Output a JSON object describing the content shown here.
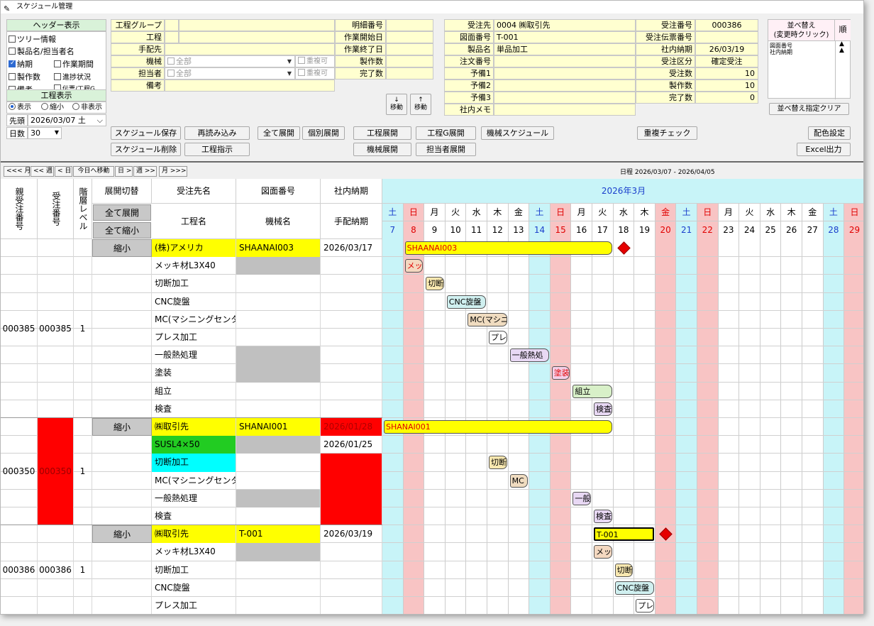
{
  "window_title": "スケジュール管理",
  "header_panel": {
    "title": "ヘッダー表示",
    "opt_tree": "ツリー情報",
    "opt_product": "製品名/担当者名",
    "opt_due": "納期",
    "opt_workperiod": "作業期間",
    "opt_qty": "製作数",
    "opt_progress": "進捗状況",
    "opt_note": "備考",
    "opt_slip": "伝票/工程G",
    "process_title": "工程表示",
    "radio_show": "表示",
    "radio_shrink": "縮小",
    "radio_hide": "非表示",
    "start_label": "先頭",
    "start_value": "2026/03/07 土",
    "days_label": "日数",
    "days_value": "30"
  },
  "filter": {
    "process_group": "工程グループ",
    "process": "工程",
    "arranger": "手配先",
    "machine": "機械",
    "machine_all": "全部",
    "dup1": "重複可",
    "staff": "担当者",
    "staff_all": "全部",
    "dup2": "重複可",
    "note": "備考",
    "detail_no": "明細番号",
    "work_start": "作業開始日",
    "work_end": "作業終了日",
    "produced": "製作数",
    "completed": "完了数"
  },
  "order": {
    "customer_label": "受注先",
    "customer_value": "0004 ㈱取引先",
    "drawing_label": "図面番号",
    "drawing_value": "T-001",
    "product_label": "製品名",
    "product_value": "単品加工",
    "po_label": "注文番号",
    "spare1": "予備1",
    "spare2": "予備2",
    "spare3": "予備3",
    "memo": "社内メモ",
    "order_no_label": "受注番号",
    "order_no_value": "000386",
    "slip_label": "受注伝票番号",
    "due_label": "社内納期",
    "due_value": "26/03/19",
    "type_label": "受注区分",
    "type_value": "確定受注",
    "qty_label": "受注数",
    "qty_value": "10",
    "made_label": "製作数",
    "made_value": "10",
    "done_label": "完了数",
    "done_value": "0"
  },
  "move": {
    "down": "↓\n移動",
    "up": "↑\n移動",
    "down_arrow": "↓",
    "up_arrow": "↑",
    "word": "移動"
  },
  "sort": {
    "title": "並べ替え\n(変更時クリック)",
    "title1": "並べ替え",
    "title2": "(変更時クリック)",
    "order_col": "順",
    "item1": "図面番号",
    "item2": "社内納期",
    "arrow1": "▲",
    "arrow2": "▲",
    "clear": "並べ替え指定クリア"
  },
  "buttons": {
    "save": "スケジュール保存",
    "reload": "再読み込み",
    "expand_all": "全て展開",
    "expand_each": "個別展開",
    "process_expand": "工程展開",
    "processg_expand": "工程G展開",
    "machine_schedule": "機械スケジュール",
    "dup_check": "重複チェック",
    "color": "配色設定",
    "delete": "スケジュール削除",
    "instruct": "工程指示",
    "machine_expand": "機械展開",
    "staff_expand": "担当者展開",
    "excel": "Excel出力"
  },
  "nav": {
    "prev_month": "<<< 月",
    "prev_week": "<< 週",
    "prev_day": "< 日",
    "today": "今日へ移動",
    "next_day": "日 >",
    "next_week": "週 >>",
    "next_month": "月 >>>",
    "range": "日程  2026/03/07 - 2026/04/05"
  },
  "grid_header": {
    "parent_no": "親受注番号",
    "order_no": "受注番号",
    "level": "階層レベル",
    "toggle": "展開切替",
    "expand_all": "全て展開",
    "shrink_all": "全て縮小",
    "customer": "受注先名",
    "process": "工程名",
    "drawing": "図面番号",
    "machine": "機械名",
    "due": "社内納期",
    "arrange_due": "手配納期",
    "month": "2026年3月"
  },
  "days": [
    {
      "w": "土",
      "d": "7",
      "t": "sat"
    },
    {
      "w": "日",
      "d": "8",
      "t": "sun"
    },
    {
      "w": "月",
      "d": "9",
      "t": ""
    },
    {
      "w": "火",
      "d": "10",
      "t": ""
    },
    {
      "w": "水",
      "d": "11",
      "t": ""
    },
    {
      "w": "木",
      "d": "12",
      "t": ""
    },
    {
      "w": "金",
      "d": "13",
      "t": ""
    },
    {
      "w": "土",
      "d": "14",
      "t": "sat"
    },
    {
      "w": "日",
      "d": "15",
      "t": "sun"
    },
    {
      "w": "月",
      "d": "16",
      "t": ""
    },
    {
      "w": "火",
      "d": "17",
      "t": ""
    },
    {
      "w": "水",
      "d": "18",
      "t": ""
    },
    {
      "w": "木",
      "d": "19",
      "t": ""
    },
    {
      "w": "金",
      "d": "20",
      "t": "hol"
    },
    {
      "w": "土",
      "d": "21",
      "t": "sat"
    },
    {
      "w": "日",
      "d": "22",
      "t": "sun"
    },
    {
      "w": "月",
      "d": "23",
      "t": ""
    },
    {
      "w": "火",
      "d": "24",
      "t": ""
    },
    {
      "w": "水",
      "d": "25",
      "t": ""
    },
    {
      "w": "木",
      "d": "26",
      "t": ""
    },
    {
      "w": "金",
      "d": "27",
      "t": ""
    },
    {
      "w": "土",
      "d": "28",
      "t": "sat"
    },
    {
      "w": "日",
      "d": "29",
      "t": "sun"
    }
  ],
  "groups": [
    {
      "parent": "000385",
      "order": "000385",
      "level": "1",
      "order_red": false,
      "rows": [
        {
          "toggle": "縮小",
          "name": "(株)アメリカ",
          "name_bg": "#ffff00",
          "drawing": "SHAANAI003",
          "drawing_bg": "#ffff00",
          "due": "2026/03/17",
          "due_bg": "",
          "bar": {
            "label": "SHAANAI003",
            "start": 1,
            "end": 10,
            "color": "#ffff00",
            "text": "#e00000",
            "diamond": 11
          }
        },
        {
          "name": "メッキ材L3X40",
          "drawing": "",
          "drawing_bg": "#c0c0c0",
          "bar": {
            "label": "メッキ",
            "start": 1,
            "end": 1,
            "color": "#f4d8c0",
            "text": "#e00000"
          }
        },
        {
          "name": "切断加工",
          "bar": {
            "label": "切断加工",
            "start": 2,
            "end": 2,
            "color": "#f8e8b0",
            "text": "#000"
          }
        },
        {
          "name": "CNC旋盤",
          "bar": {
            "label": "CNC旋盤",
            "start": 3,
            "end": 4,
            "color": "#d0f0f0",
            "text": "#000"
          }
        },
        {
          "name": "MC(マシニングセンタ)",
          "bar": {
            "label": "MC(マシニ",
            "start": 4,
            "end": 5,
            "color": "#f0dcc0",
            "text": "#000"
          }
        },
        {
          "name": "プレス加工",
          "bar": {
            "label": "プレ",
            "start": 5,
            "end": 5,
            "color": "#ffffff",
            "text": "#000"
          }
        },
        {
          "name": "一般熱処理",
          "drawing": "",
          "drawing_bg": "#c0c0c0",
          "bar": {
            "label": "一般熱処",
            "start": 6,
            "end": 7,
            "color": "#e8d8f4",
            "text": "#000"
          }
        },
        {
          "name": "塗装",
          "drawing": "",
          "drawing_bg": "#c0c0c0",
          "bar": {
            "label": "塗装",
            "start": 8,
            "end": 8,
            "color": "#f4d0e8",
            "text": "#e00000"
          }
        },
        {
          "name": "組立",
          "bar": {
            "label": "組立",
            "start": 9,
            "end": 10,
            "color": "#d8f0c8",
            "text": "#000"
          }
        },
        {
          "name": "検査",
          "bar": {
            "label": "検査",
            "start": 10,
            "end": 10,
            "color": "#e8d8f4",
            "text": "#000"
          }
        }
      ]
    },
    {
      "parent": "000350",
      "order": "000350",
      "level": "1",
      "order_red": true,
      "rows": [
        {
          "toggle": "縮小",
          "name": "㈱取引先",
          "name_bg": "#ffff00",
          "drawing": "SHANAI001",
          "drawing_bg": "#ffff00",
          "due": "2026/01/28",
          "due_bg": "#ff0000",
          "bar": {
            "label": "SHANAI001",
            "start": 0,
            "end": 10,
            "color": "#ffff00",
            "text": "#e00000"
          }
        },
        {
          "name": "SUSL4×50",
          "name_bg": "#22cc22",
          "drawing": "",
          "drawing_bg": "#c0c0c0",
          "due": "2026/01/25",
          "due_bg": ""
        },
        {
          "name": "切断加工",
          "name_bg": "#00ffff",
          "due": "",
          "due_bg": "#ff0000",
          "bar": {
            "label": "切断",
            "start": 5,
            "end": 5,
            "color": "#f8e8b0",
            "text": "#000"
          }
        },
        {
          "name": "MC(マシニングセンタ)",
          "due_bg": "#ff0000",
          "bar": {
            "label": "MC",
            "start": 6,
            "end": 6,
            "color": "#f0dcc0",
            "text": "#000"
          }
        },
        {
          "name": "一般熱処理",
          "drawing": "",
          "drawing_bg": "#c0c0c0",
          "due_bg": "#ff0000",
          "bar": {
            "label": "一般",
            "start": 9,
            "end": 9,
            "color": "#e8d8f4",
            "text": "#000"
          }
        },
        {
          "name": "検査",
          "due_bg": "#ff0000",
          "bar": {
            "label": "検査",
            "start": 10,
            "end": 10,
            "color": "#e8d8f4",
            "text": "#000"
          }
        }
      ]
    },
    {
      "parent": "000386",
      "order": "000386",
      "level": "1",
      "order_red": false,
      "rows": [
        {
          "toggle": "縮小",
          "name": "㈱取引先",
          "name_bg": "#ffff00",
          "drawing": "T-001",
          "drawing_bg": "#ffff00",
          "due": "2026/03/19",
          "due_bg": "",
          "bar": {
            "label": "T-001",
            "start": 10,
            "end": 12,
            "color": "#ffff00",
            "text": "#000",
            "sel": true,
            "diamond": 13
          }
        },
        {
          "name": "メッキ材L3X40",
          "drawing": "",
          "drawing_bg": "#c0c0c0",
          "bar": {
            "label": "メッキ",
            "start": 10,
            "end": 10,
            "color": "#f4d8c0",
            "text": "#000"
          }
        },
        {
          "name": "切断加工",
          "bar": {
            "label": "切断",
            "start": 11,
            "end": 11,
            "color": "#f8e8b0",
            "text": "#000"
          }
        },
        {
          "name": "CNC旋盤",
          "bar": {
            "label": "CNC旋盤",
            "start": 11,
            "end": 12,
            "color": "#d0f0f0",
            "text": "#000"
          }
        },
        {
          "name": "プレス加工",
          "bar": {
            "label": "プレ",
            "start": 12,
            "end": 12,
            "color": "#ffffff",
            "text": "#000"
          }
        }
      ]
    }
  ]
}
